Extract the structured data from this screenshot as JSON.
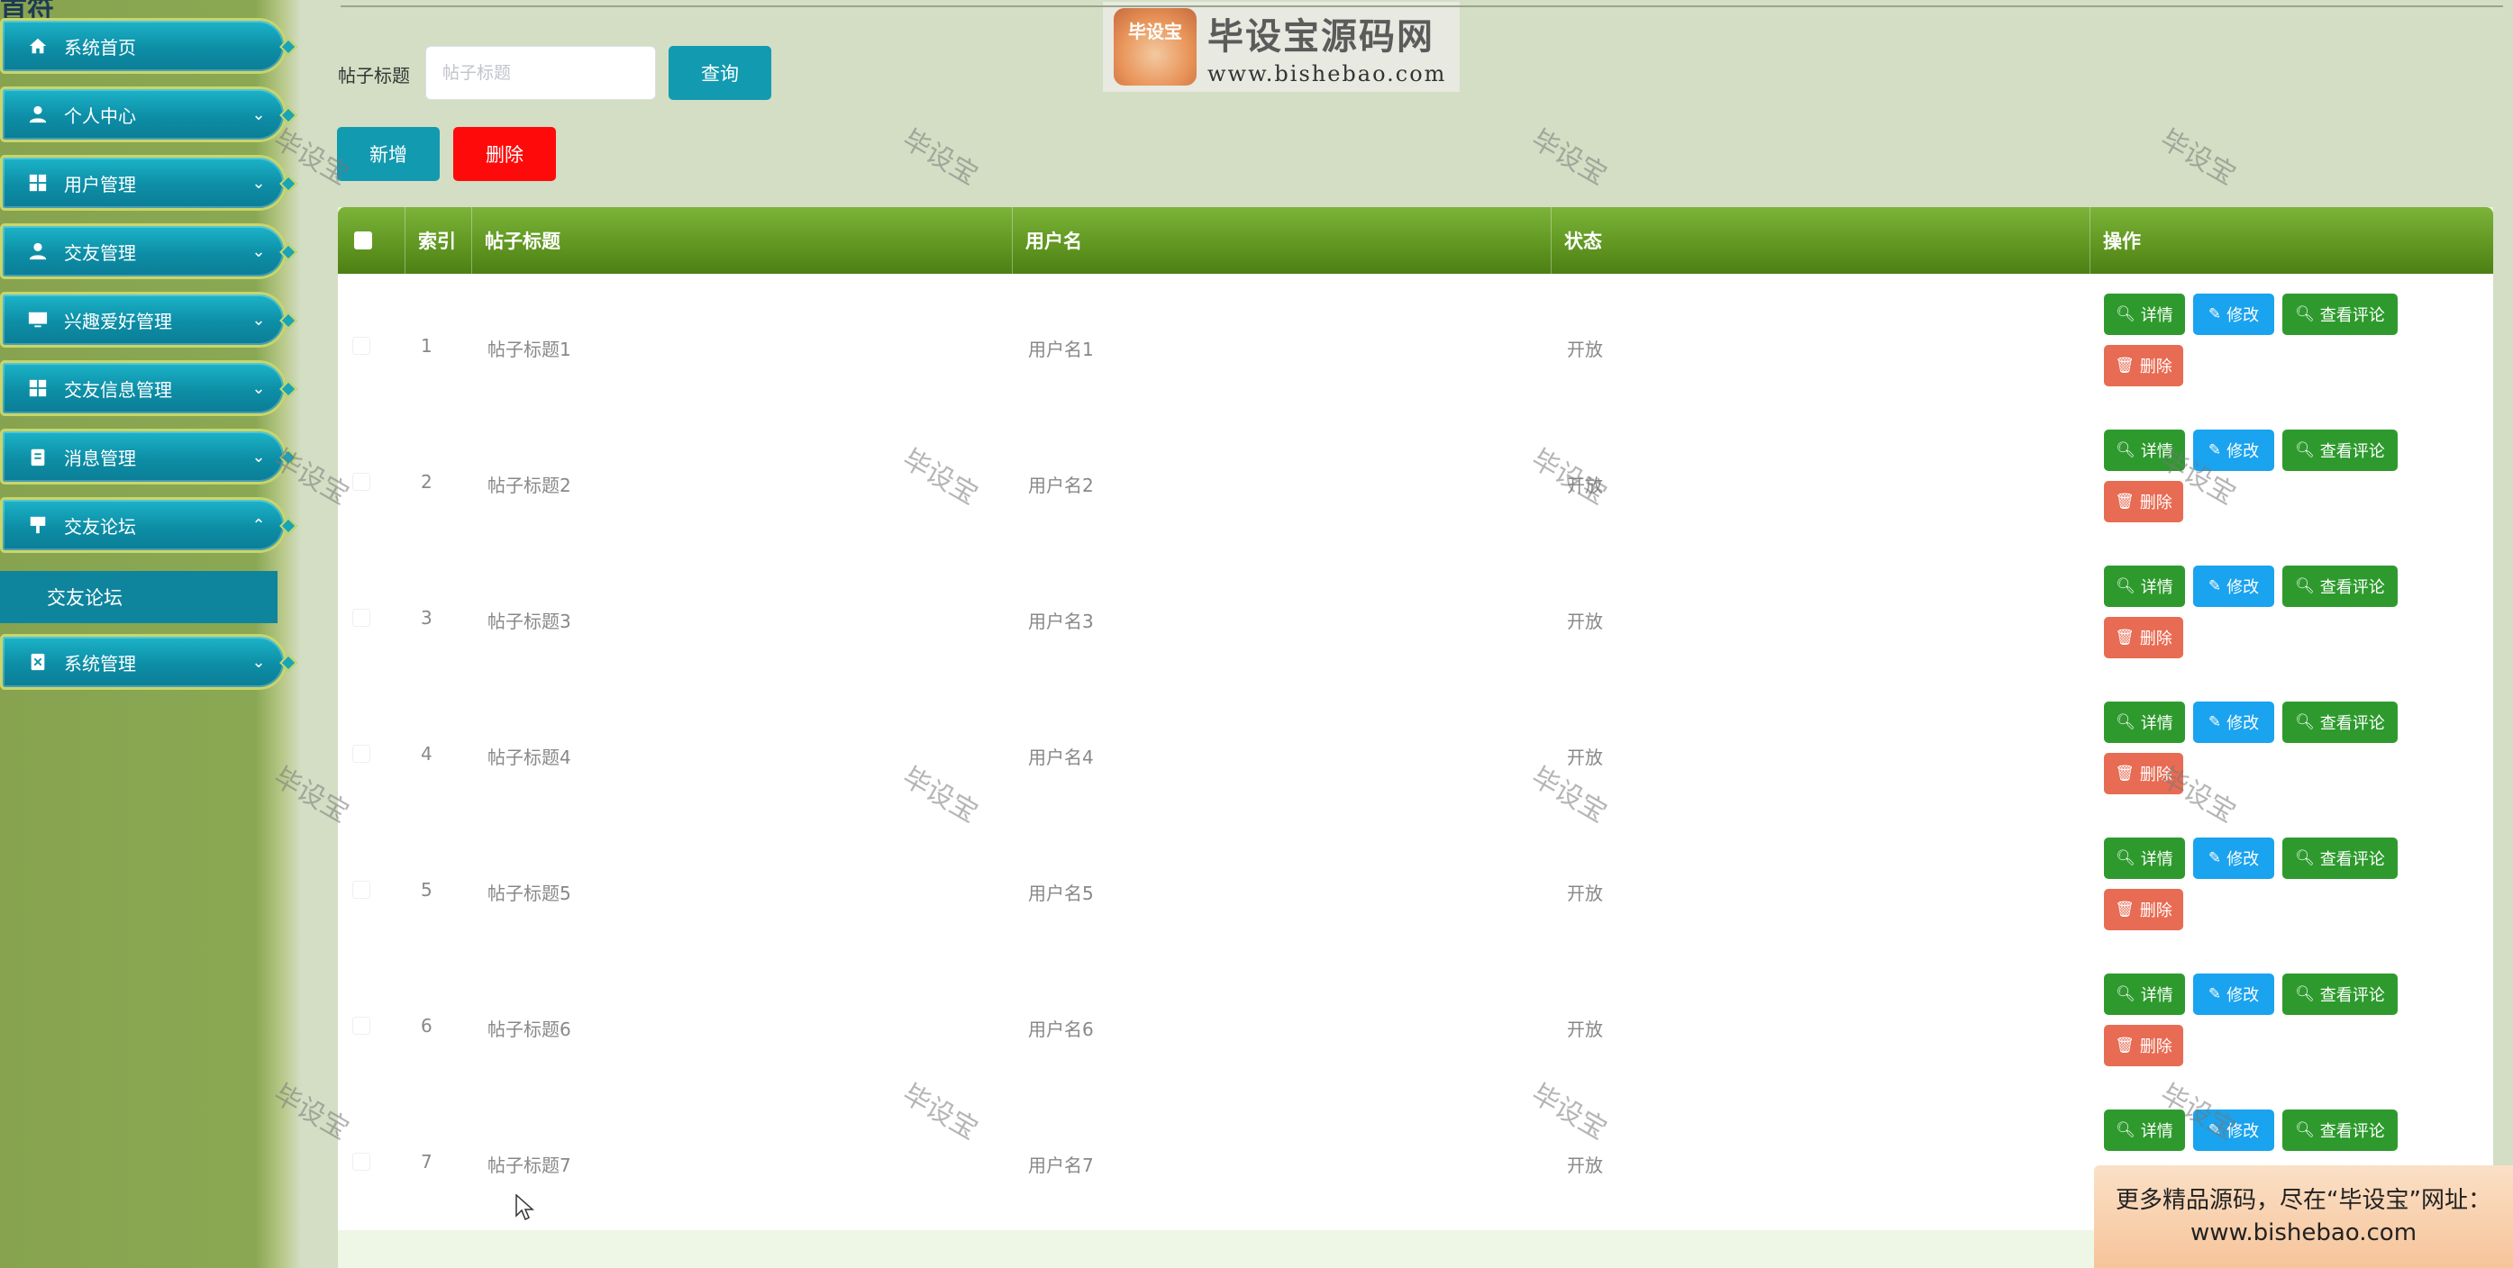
{
  "sidebar": {
    "partial_title": "首符",
    "menu": [
      {
        "label": "系统首页",
        "icon": "home-icon",
        "arrow": ""
      },
      {
        "label": "个人中心",
        "icon": "user-icon",
        "arrow": "⌄"
      },
      {
        "label": "用户管理",
        "icon": "grid-icon",
        "arrow": "⌄"
      },
      {
        "label": "交友管理",
        "icon": "user-icon",
        "arrow": "⌄"
      },
      {
        "label": "兴趣爱好管理",
        "icon": "monitor-icon",
        "arrow": "⌄"
      },
      {
        "label": "交友信息管理",
        "icon": "grid-icon",
        "arrow": "⌄"
      },
      {
        "label": "消息管理",
        "icon": "clipboard-icon",
        "arrow": "⌄"
      },
      {
        "label": "交友论坛",
        "icon": "pin-icon",
        "arrow": "⌃"
      },
      {
        "label": "系统管理",
        "icon": "settings-doc-icon",
        "arrow": "⌄"
      }
    ],
    "submenu_label": "交友论坛"
  },
  "logo": {
    "badge_text": "毕设宝",
    "cn_text": "毕设宝源码网",
    "url_text": "www.bishebao.com"
  },
  "search": {
    "label": "帖子标题",
    "placeholder": "帖子标题",
    "query_button": "查询"
  },
  "actions": {
    "add_button": "新增",
    "delete_button": "删除"
  },
  "table": {
    "headers": {
      "index": "索引",
      "title": "帖子标题",
      "user": "用户名",
      "status": "状态",
      "operation": "操作"
    },
    "buttons": {
      "detail": "详情",
      "edit": "修改",
      "comments": "查看评论",
      "delete": "删除"
    },
    "rows": [
      {
        "index": "1",
        "title": "帖子标题1",
        "user": "用户名1",
        "status": "开放"
      },
      {
        "index": "2",
        "title": "帖子标题2",
        "user": "用户名2",
        "status": "开放"
      },
      {
        "index": "3",
        "title": "帖子标题3",
        "user": "用户名3",
        "status": "开放"
      },
      {
        "index": "4",
        "title": "帖子标题4",
        "user": "用户名4",
        "status": "开放"
      },
      {
        "index": "5",
        "title": "帖子标题5",
        "user": "用户名5",
        "status": "开放"
      },
      {
        "index": "6",
        "title": "帖子标题6",
        "user": "用户名6",
        "status": "开放"
      },
      {
        "index": "7",
        "title": "帖子标题7",
        "user": "用户名7",
        "status": "开放"
      }
    ]
  },
  "watermark_text": "毕设宝",
  "banner": {
    "line1": "更多精品源码，尽在“毕设宝”网址：",
    "line2": "www.bishebao.com"
  },
  "colors": {
    "sidebar_bg": "#87a34f",
    "menu_item": "#0d8ea6",
    "header_green": "#5f9520",
    "primary": "#129ab0",
    "danger": "#ff0a0a",
    "detail_green": "#2e9a2e",
    "edit_blue": "#1aa3ee",
    "delete_row": "#e86b53"
  }
}
